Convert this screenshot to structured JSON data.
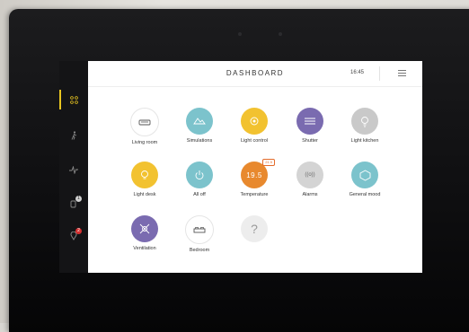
{
  "header": {
    "title": "DASHBOARD",
    "time": "16:45"
  },
  "tiles": [
    {
      "label": "Living room",
      "icon": "sofa-icon",
      "color": "#ffffff"
    },
    {
      "label": "Simulations",
      "icon": "simulation-icon",
      "color": "#7cc3cc"
    },
    {
      "label": "Light control",
      "icon": "bulb-icon",
      "color": "#f2c230"
    },
    {
      "label": "Shutter",
      "icon": "shutter-icon",
      "color": "#7a6bb0"
    },
    {
      "label": "Light kitchen",
      "icon": "bulb-icon",
      "color": "#c9c9c9"
    },
    {
      "label": "Light desk",
      "icon": "bulb-icon",
      "color": "#f2c230"
    },
    {
      "label": "All off",
      "icon": "power-icon",
      "color": "#7cc3cc"
    },
    {
      "label": "Temperature",
      "icon": "thermostat-icon",
      "color": "#e8892e",
      "value": "19.5",
      "tag": "21.5"
    },
    {
      "label": "Alarms",
      "icon": "alarm-icon",
      "color": "#d4d4d4",
      "value": "((o))"
    },
    {
      "label": "General mood",
      "icon": "mood-icon",
      "color": "#7cc3cc"
    },
    {
      "label": "Ventilation",
      "icon": "fan-icon",
      "color": "#7a6bb0"
    },
    {
      "label": "Bedroom",
      "icon": "bed-icon",
      "color": "#ffffff"
    },
    {
      "label": "",
      "icon": "question-icon",
      "color": "#ededed",
      "value": "?"
    }
  ],
  "sidebar": {
    "badges": {
      "devices": "1",
      "alerts": "2"
    }
  }
}
